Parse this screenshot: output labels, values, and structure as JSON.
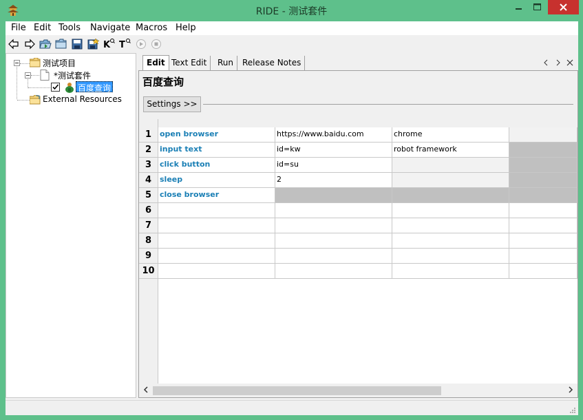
{
  "window": {
    "title": "RIDE - 测试套件",
    "app_icon": "ride-pagoda-icon"
  },
  "menu": [
    "File",
    "Edit",
    "Tools",
    "Navigate",
    "Macros",
    "Help"
  ],
  "toolbar": {
    "icons": [
      "back-arrow-icon",
      "forward-arrow-icon",
      "open-folder-icon",
      "folder-icon",
      "save-icon",
      "save-all-icon",
      "search-keyword-icon",
      "search-test-icon",
      "run-icon",
      "stop-icon"
    ]
  },
  "tree": {
    "project": "测试项目",
    "suite": "*测试套件",
    "testcase": "百度查询",
    "external": "External Resources"
  },
  "tabs": [
    "Edit",
    "Text Edit",
    "Run",
    "Release Notes"
  ],
  "editor": {
    "title": "百度查询",
    "settings_label": "Settings >>"
  },
  "grid": {
    "rows": [
      {
        "num": "1",
        "cells": [
          "open browser",
          "https://www.baidu.com",
          "chrome",
          ""
        ]
      },
      {
        "num": "2",
        "cells": [
          "input text",
          "id=kw",
          "robot framework",
          ""
        ]
      },
      {
        "num": "3",
        "cells": [
          "click button",
          "id=su",
          "",
          ""
        ]
      },
      {
        "num": "4",
        "cells": [
          "sleep",
          "2",
          "",
          ""
        ]
      },
      {
        "num": "5",
        "cells": [
          "close browser",
          "",
          "",
          ""
        ]
      },
      {
        "num": "6",
        "cells": [
          "",
          "",
          "",
          ""
        ]
      },
      {
        "num": "7",
        "cells": [
          "",
          "",
          "",
          ""
        ]
      },
      {
        "num": "8",
        "cells": [
          "",
          "",
          "",
          ""
        ]
      },
      {
        "num": "9",
        "cells": [
          "",
          "",
          "",
          ""
        ]
      },
      {
        "num": "10",
        "cells": [
          "",
          "",
          "",
          ""
        ]
      }
    ]
  },
  "colors": {
    "window_frame": "#5ec08b",
    "keyword": "#1a7fb5",
    "selected": "#3399ff",
    "close_button": "#c7312e"
  }
}
